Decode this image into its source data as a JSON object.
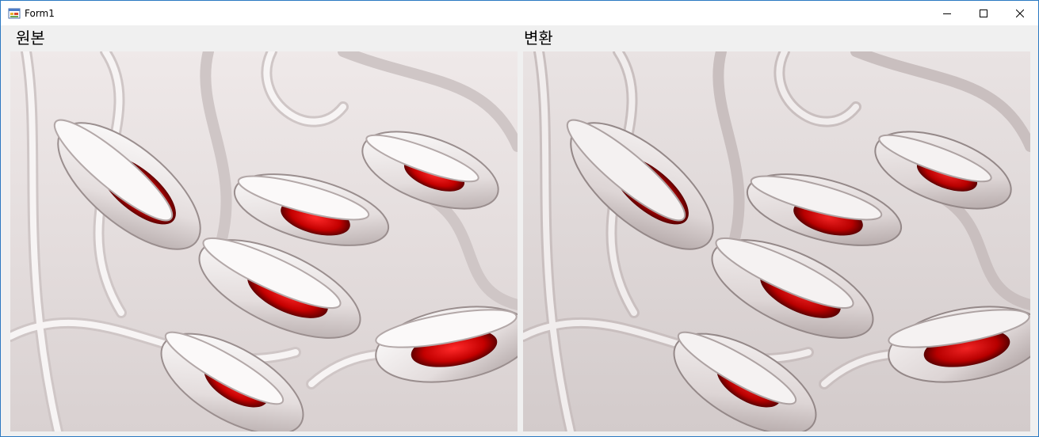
{
  "window": {
    "title": "Form1",
    "icon": "winforms-app-icon"
  },
  "controls": {
    "minimize_icon": "minimize-icon",
    "maximize_icon": "maximize-icon",
    "close_icon": "close-icon"
  },
  "panes": {
    "original": {
      "label": "원본"
    },
    "converted": {
      "label": "변환"
    }
  },
  "colors": {
    "background": "#f0f0f0",
    "accent_border": "#2b79c2",
    "image_ribbon": "#f4f1f1",
    "image_shadow": "#b7adad",
    "image_red": "#cc0000"
  }
}
